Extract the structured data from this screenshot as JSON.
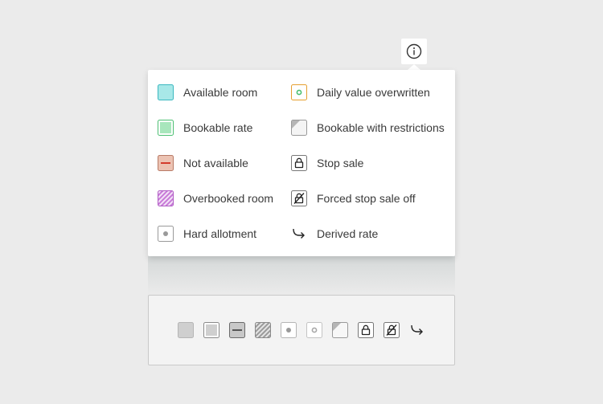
{
  "info": {
    "icon": "info-icon"
  },
  "legend": {
    "items": [
      {
        "label": "Available room",
        "icon": "available-room-swatch",
        "color": "#a8e8e8"
      },
      {
        "label": "Bookable rate",
        "icon": "bookable-rate-swatch",
        "color": "#a8e6bc"
      },
      {
        "label": "Not available",
        "icon": "not-available-swatch",
        "color": "#e9b9a8"
      },
      {
        "label": "Overbooked room",
        "icon": "overbooked-room-swatch",
        "color": "#c87ad8"
      },
      {
        "label": "Hard allotment",
        "icon": "hard-allotment-swatch",
        "color": "#9a9a9a"
      },
      {
        "label": "Daily value overwritten",
        "icon": "daily-value-overwritten-swatch",
        "color": "#e6a030"
      },
      {
        "label": "Bookable with restrictions",
        "icon": "bookable-with-restrictions-swatch",
        "color": "#b5b5b5"
      },
      {
        "label": "Stop sale",
        "icon": "lock-icon",
        "color": "#333333"
      },
      {
        "label": "Forced stop sale off",
        "icon": "lock-crossed-icon",
        "color": "#333333"
      },
      {
        "label": "Derived rate",
        "icon": "derived-arrow-icon",
        "color": "#333333"
      }
    ]
  }
}
